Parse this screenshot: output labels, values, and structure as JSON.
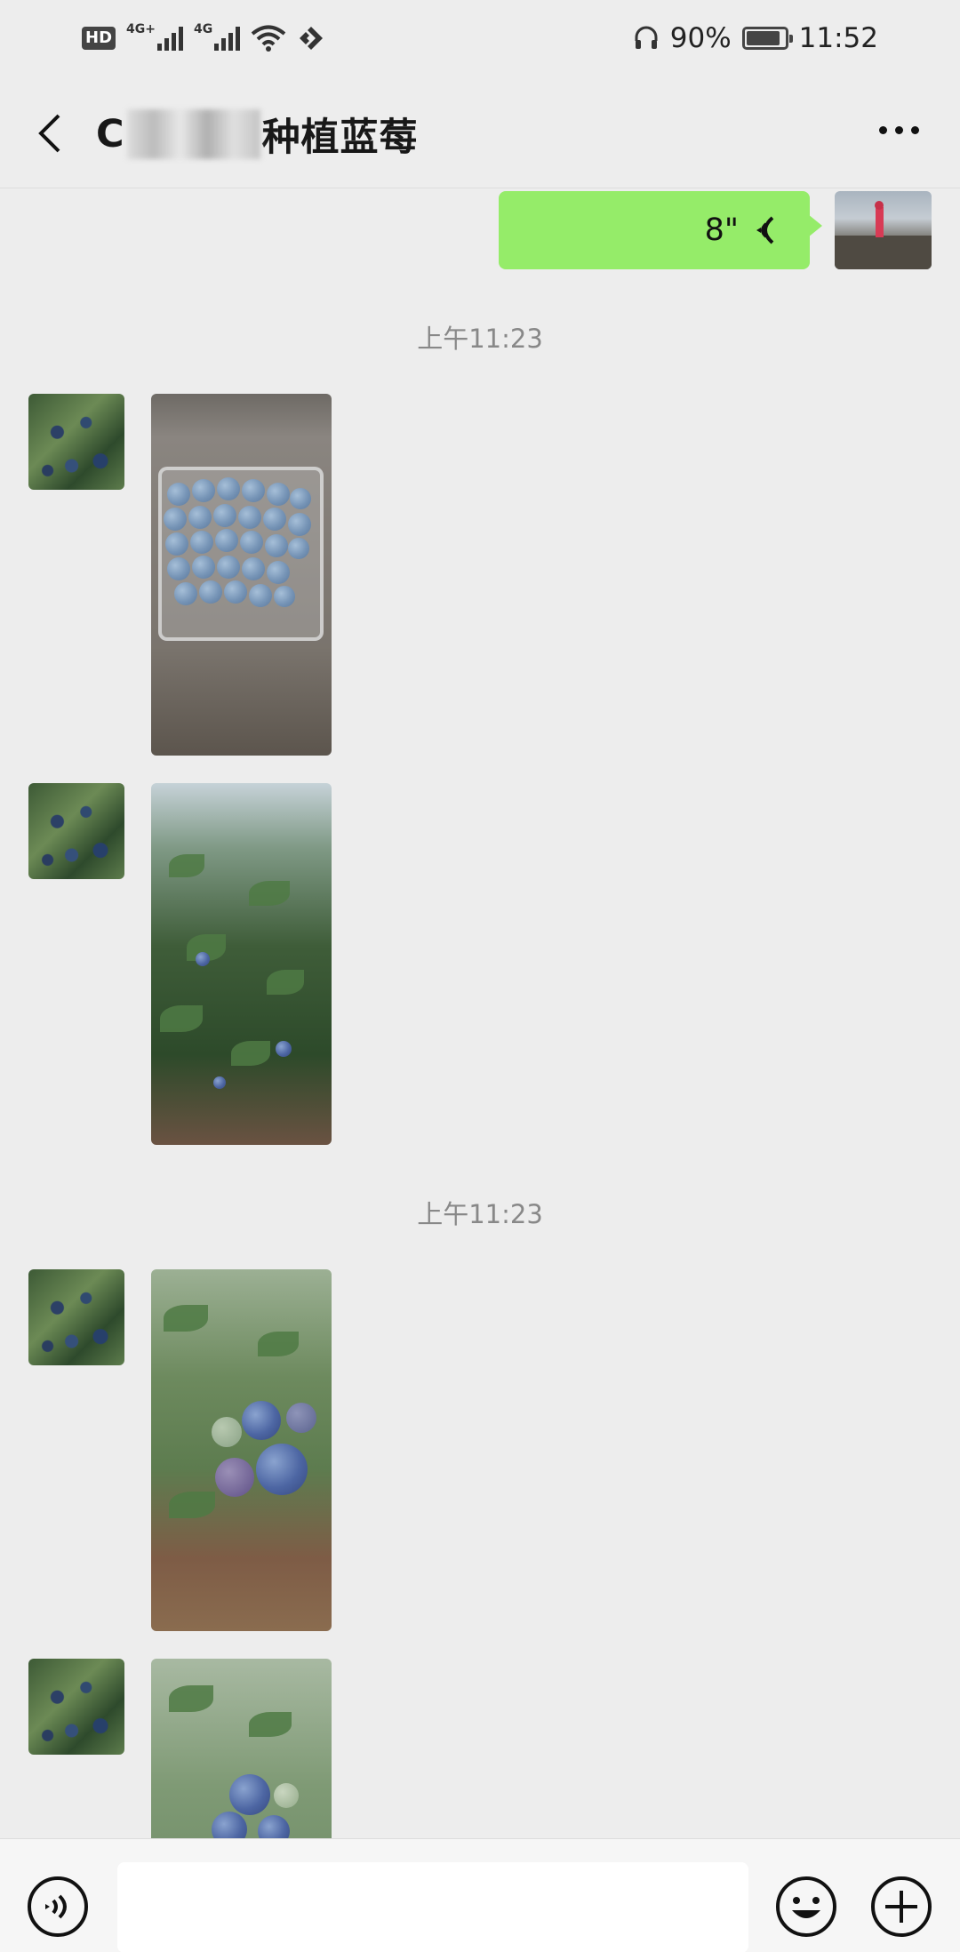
{
  "status_bar": {
    "hd_label": "HD",
    "network_1": "4G+",
    "network_2": "4G",
    "battery_percent": "90%",
    "battery_level": 0.9,
    "time": "11:52"
  },
  "header": {
    "title_prefix": "C",
    "title_suffix": "种植蓝莓"
  },
  "messages": {
    "voice_duration": "8\"",
    "timestamp_1": "上午11:23",
    "timestamp_2": "上午11:23"
  },
  "input_bar": {
    "placeholder": ""
  },
  "icons": {
    "back": "chevron-left-icon",
    "more": "more-icon",
    "voice_mode": "voice-icon",
    "emoji": "emoji-icon",
    "plus": "plus-icon",
    "voice_wave": "voice-wave-icon"
  },
  "colors": {
    "background": "#ededed",
    "sent_bubble": "#95ec69",
    "timestamp": "#888888"
  }
}
